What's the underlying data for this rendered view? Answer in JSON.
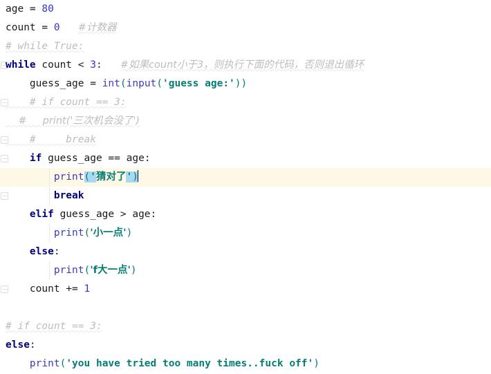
{
  "editor": {
    "language": "python",
    "theme": "light",
    "colors": {
      "background": "#ffffff",
      "keyword": "#000080",
      "builtin": "#3b3bbd",
      "number": "#3333cc",
      "string": "#067d74",
      "comment": "#bdbdbd",
      "caret_line": "#fdf9e6",
      "selection": "#a9d9f2",
      "indent_guide": "#e8e8e8",
      "fold_marker": "#dcdcdc"
    }
  },
  "lines": [
    {
      "index": 1,
      "indent": 0,
      "fold": false,
      "guide": 0,
      "caret_line": false,
      "tokens": [
        {
          "t": "plain",
          "v": "age "
        },
        {
          "t": "op",
          "v": "= "
        },
        {
          "t": "num",
          "v": "80"
        }
      ]
    },
    {
      "index": 2,
      "indent": 0,
      "fold": false,
      "guide": 0,
      "caret_line": false,
      "tokens": [
        {
          "t": "plain",
          "v": "count "
        },
        {
          "t": "op",
          "v": "= "
        },
        {
          "t": "num",
          "v": "0"
        },
        {
          "t": "plain",
          "v": "   "
        },
        {
          "t": "cmt",
          "v": "#计数器"
        }
      ]
    },
    {
      "index": 3,
      "indent": 0,
      "fold": false,
      "guide": 0,
      "caret_line": false,
      "tokens": [
        {
          "t": "cmt",
          "v": "# while True:"
        }
      ]
    },
    {
      "index": 4,
      "indent": 0,
      "fold": true,
      "guide": 0,
      "caret_line": false,
      "tokens": [
        {
          "t": "kw",
          "v": "while"
        },
        {
          "t": "plain",
          "v": " count "
        },
        {
          "t": "op",
          "v": "< "
        },
        {
          "t": "num",
          "v": "3"
        },
        {
          "t": "plain",
          "v": ":   "
        },
        {
          "t": "cmt",
          "v": "#如果count小于3，则执行下面的代码，否则退出循环"
        }
      ]
    },
    {
      "index": 5,
      "indent": 1,
      "fold": false,
      "guide": 0,
      "caret_line": false,
      "tokens": [
        {
          "t": "plain",
          "v": "    guess_age "
        },
        {
          "t": "op",
          "v": "= "
        },
        {
          "t": "bi",
          "v": "int"
        },
        {
          "t": "punc",
          "v": "("
        },
        {
          "t": "bi",
          "v": "input"
        },
        {
          "t": "punc",
          "v": "("
        },
        {
          "t": "str",
          "v": "'guess age:'"
        },
        {
          "t": "punc",
          "v": "))"
        }
      ]
    },
    {
      "index": 6,
      "indent": 1,
      "fold": true,
      "guide": 0,
      "caret_line": false,
      "tokens": [
        {
          "t": "cmt",
          "v": "    # if count == 3:"
        }
      ]
    },
    {
      "index": 7,
      "indent": 1,
      "fold": false,
      "guide": 0,
      "caret_line": false,
      "tokens": [
        {
          "t": "cmt",
          "v": "    #     print('三次机会没了')"
        }
      ]
    },
    {
      "index": 8,
      "indent": 1,
      "fold": true,
      "guide": 0,
      "caret_line": false,
      "tokens": [
        {
          "t": "cmt",
          "v": "    #     break"
        }
      ]
    },
    {
      "index": 9,
      "indent": 1,
      "fold": true,
      "guide": 0,
      "caret_line": false,
      "tokens": [
        {
          "t": "plain",
          "v": "    "
        },
        {
          "t": "kw",
          "v": "if"
        },
        {
          "t": "plain",
          "v": " guess_age "
        },
        {
          "t": "op",
          "v": "== "
        },
        {
          "t": "plain",
          "v": "age:"
        }
      ]
    },
    {
      "index": 10,
      "indent": 2,
      "fold": false,
      "guide": 2,
      "caret_line": true,
      "tokens": [
        {
          "t": "plain",
          "v": "        "
        },
        {
          "t": "bi",
          "v": "print"
        },
        {
          "t": "sel-punc",
          "v": "("
        },
        {
          "t": "sel-str",
          "v": "'"
        },
        {
          "t": "str",
          "v": "猜对了"
        },
        {
          "t": "sel-str",
          "v": "'"
        },
        {
          "t": "sel-punc",
          "v": ")"
        },
        {
          "t": "caret",
          "v": ""
        }
      ]
    },
    {
      "index": 11,
      "indent": 2,
      "fold": true,
      "guide": 2,
      "caret_line": false,
      "tokens": [
        {
          "t": "plain",
          "v": "        "
        },
        {
          "t": "kw",
          "v": "break"
        }
      ]
    },
    {
      "index": 12,
      "indent": 1,
      "fold": false,
      "guide": 0,
      "caret_line": false,
      "tokens": [
        {
          "t": "plain",
          "v": "    "
        },
        {
          "t": "kw",
          "v": "elif"
        },
        {
          "t": "plain",
          "v": " guess_age "
        },
        {
          "t": "op",
          "v": "> "
        },
        {
          "t": "plain",
          "v": "age:"
        }
      ]
    },
    {
      "index": 13,
      "indent": 2,
      "fold": false,
      "guide": 2,
      "caret_line": false,
      "tokens": [
        {
          "t": "plain",
          "v": "        "
        },
        {
          "t": "bi",
          "v": "print"
        },
        {
          "t": "punc",
          "v": "("
        },
        {
          "t": "str",
          "v": "'小一点'"
        },
        {
          "t": "punc",
          "v": ")"
        }
      ]
    },
    {
      "index": 14,
      "indent": 1,
      "fold": false,
      "guide": 0,
      "caret_line": false,
      "tokens": [
        {
          "t": "plain",
          "v": "    "
        },
        {
          "t": "kw",
          "v": "else"
        },
        {
          "t": "plain",
          "v": ":"
        }
      ]
    },
    {
      "index": 15,
      "indent": 2,
      "fold": false,
      "guide": 2,
      "caret_line": false,
      "tokens": [
        {
          "t": "plain",
          "v": "        "
        },
        {
          "t": "bi",
          "v": "print"
        },
        {
          "t": "punc",
          "v": "("
        },
        {
          "t": "str",
          "v": "'f大一点'"
        },
        {
          "t": "punc",
          "v": ")"
        }
      ]
    },
    {
      "index": 16,
      "indent": 1,
      "fold": true,
      "guide": 0,
      "caret_line": false,
      "tokens": [
        {
          "t": "plain",
          "v": "    count "
        },
        {
          "t": "op",
          "v": "+= "
        },
        {
          "t": "num",
          "v": "1"
        }
      ]
    },
    {
      "index": 17,
      "indent": 0,
      "fold": false,
      "guide": 0,
      "caret_line": false,
      "tokens": []
    },
    {
      "index": 18,
      "indent": 0,
      "fold": false,
      "guide": 0,
      "caret_line": false,
      "tokens": [
        {
          "t": "cmt",
          "v": "# if count == 3:"
        }
      ]
    },
    {
      "index": 19,
      "indent": 0,
      "fold": false,
      "guide": 0,
      "caret_line": false,
      "tokens": [
        {
          "t": "kw",
          "v": "else"
        },
        {
          "t": "plain",
          "v": ":"
        }
      ]
    },
    {
      "index": 20,
      "indent": 1,
      "fold": false,
      "guide": 0,
      "caret_line": false,
      "tokens": [
        {
          "t": "plain",
          "v": "    "
        },
        {
          "t": "bi",
          "v": "print"
        },
        {
          "t": "punc",
          "v": "("
        },
        {
          "t": "str",
          "v": "'you have tried too many times..fuck off'"
        },
        {
          "t": "punc",
          "v": ")"
        }
      ]
    }
  ]
}
